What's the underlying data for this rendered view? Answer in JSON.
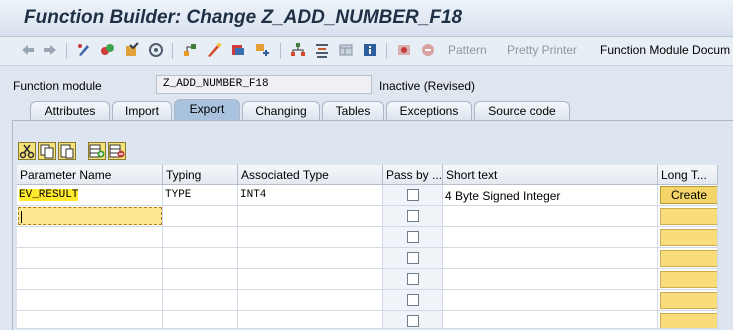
{
  "title": "Function Builder: Change Z_ADD_NUMBER_F18",
  "toolbar": {
    "icons": [
      "back-arrow-icon",
      "forward-arrow-icon",
      "display-change-icon",
      "activate-icon",
      "check-icon",
      "test-icon",
      "where-used-icon",
      "object-list-icon",
      "navigation-icon",
      "hierarchy-icon",
      "pretty-icon",
      "window-icon",
      "info-icon",
      "insert-statement-icon",
      "breakpoint-icon"
    ],
    "pattern": "Pattern",
    "pretty_printer": "Pretty Printer",
    "function_module_doc": "Function Module Docum"
  },
  "function_module": {
    "label": "Function module",
    "value": "Z_ADD_NUMBER_F18",
    "status": "Inactive (Revised)"
  },
  "tabs": [
    "Attributes",
    "Import",
    "Export",
    "Changing",
    "Tables",
    "Exceptions",
    "Source code"
  ],
  "active_tab": "Export",
  "grid": {
    "headers": [
      "Parameter Name",
      "Typing",
      "Associated Type",
      "Pass by ...",
      "Short text",
      "Long T..."
    ],
    "row1": {
      "name": "EV_RESULT",
      "typing": "TYPE",
      "assoc": "INT4",
      "short_text": "4 Byte Signed Integer",
      "long_text_button": "Create"
    }
  },
  "colors": {
    "highlight": "#ffea2c",
    "active_tab": "#a9c2de",
    "long_text_button": "#f4d56a"
  }
}
